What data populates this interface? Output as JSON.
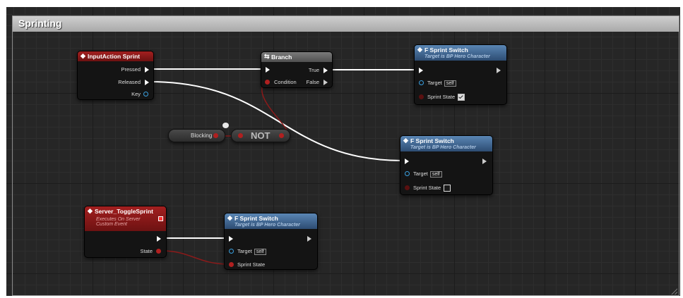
{
  "comment": {
    "title": "Sprinting"
  },
  "nodes": {
    "input_action": {
      "title": "InputAction Sprint",
      "pins": {
        "pressed": "Pressed",
        "released": "Released",
        "key": "Key"
      }
    },
    "branch": {
      "title": "Branch",
      "pins": {
        "condition": "Condition",
        "true_label": "True",
        "false_label": "False"
      }
    },
    "switch1": {
      "title": "F Sprint Switch",
      "subtitle": "Target is BP Hero Character",
      "target": "Target",
      "self": "self",
      "state": "Sprint State",
      "checked": true
    },
    "switch2": {
      "title": "F Sprint Switch",
      "subtitle": "Target is BP Hero Character",
      "target": "Target",
      "self": "self",
      "state": "Sprint State",
      "checked": false
    },
    "switch3": {
      "title": "F Sprint Switch",
      "subtitle": "Target is BP Hero Character",
      "target": "Target",
      "self": "self",
      "state": "Sprint State"
    },
    "blocking": {
      "label": "Blocking"
    },
    "not": {
      "label": "NOT"
    },
    "server_event": {
      "title": "Server_ToggleSprint",
      "line1": "Executes On Server",
      "line2": "Custom Event",
      "state": "State"
    }
  },
  "colors": {
    "exec_wire": "#ffffff",
    "bool_wire": "#8b1a1a",
    "event_header": "#a31f1f",
    "function_header": "#5a86b4",
    "object_pin": "#3aa0e0"
  }
}
